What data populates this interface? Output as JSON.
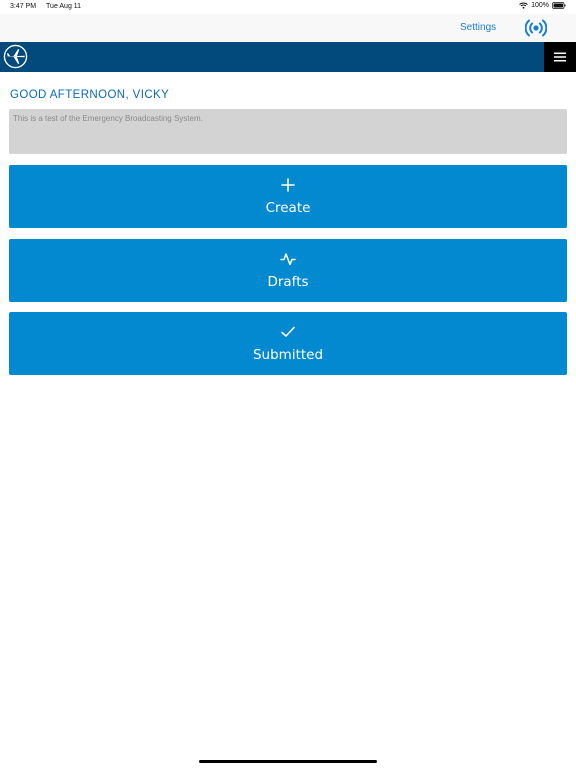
{
  "status_bar": {
    "time": "3:47 PM",
    "date": "Tue Aug 11",
    "battery": "100%"
  },
  "nav": {
    "settings_label": "Settings"
  },
  "greeting": "GOOD AFTERNOON, VICKY",
  "message": "This is a test of the Emergency Broadcasting System.",
  "actions": [
    {
      "label": "Create",
      "icon": "plus-icon"
    },
    {
      "label": "Drafts",
      "icon": "activity-icon"
    },
    {
      "label": "Submitted",
      "icon": "checkmark-icon"
    }
  ],
  "colors": {
    "header": "#034a7c",
    "accent": "#0389d0",
    "greeting": "#0a6bb2",
    "message_bg": "#d3d3d3"
  }
}
